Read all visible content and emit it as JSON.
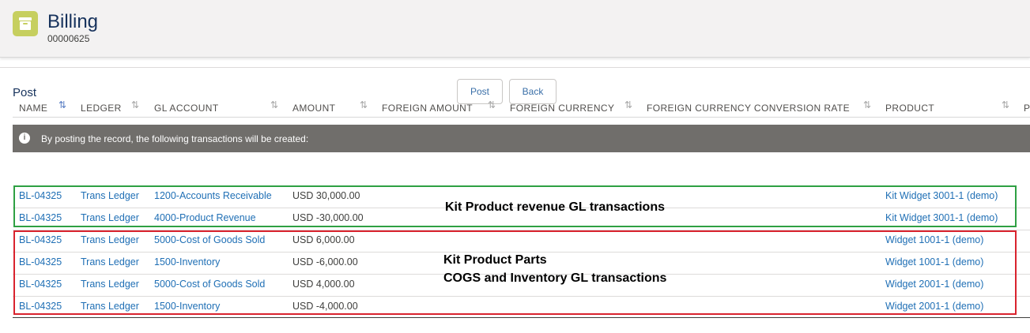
{
  "header": {
    "title": "Billing",
    "record_number": "00000625",
    "icon": "archive-icon"
  },
  "post_section": {
    "label": "Post",
    "post_button": "Post",
    "back_button": "Back"
  },
  "info": {
    "text": "By posting the record, the following transactions will be created:",
    "icon": "info-icon"
  },
  "table": {
    "columns": [
      "NAME",
      "LEDGER",
      "GL ACCOUNT",
      "AMOUNT",
      "FOREIGN AMOUNT",
      "FOREIGN CURRENCY",
      "FOREIGN CURRENCY CONVERSION RATE",
      "PRODUCT",
      "P"
    ],
    "rows": [
      {
        "name": "BL-04325",
        "ledger": "Trans Ledger",
        "gl_account": "1200-Accounts Receivable",
        "amount": "USD 30,000.00",
        "product": "Kit Widget 3001-1 (demo)"
      },
      {
        "name": "BL-04325",
        "ledger": "Trans Ledger",
        "gl_account": "4000-Product Revenue",
        "amount": "USD -30,000.00",
        "product": "Kit Widget 3001-1 (demo)"
      },
      {
        "name": "BL-04325",
        "ledger": "Trans Ledger",
        "gl_account": "5000-Cost of Goods Sold",
        "amount": "USD 6,000.00",
        "product": "Widget 1001-1 (demo)"
      },
      {
        "name": "BL-04325",
        "ledger": "Trans Ledger",
        "gl_account": "1500-Inventory",
        "amount": "USD -6,000.00",
        "product": "Widget 1001-1 (demo)"
      },
      {
        "name": "BL-04325",
        "ledger": "Trans Ledger",
        "gl_account": "5000-Cost of Goods Sold",
        "amount": "USD 4,000.00",
        "product": "Widget 2001-1 (demo)"
      },
      {
        "name": "BL-04325",
        "ledger": "Trans Ledger",
        "gl_account": "1500-Inventory",
        "amount": "USD -4,000.00",
        "product": "Widget 2001-1 (demo)"
      }
    ]
  },
  "annotations": {
    "revenue": "Kit Product revenue GL transactions",
    "parts_line1": "Kit Product Parts",
    "parts_line2": "COGS and Inventory GL transactions",
    "revenue_box_color": "#2ea043",
    "parts_box_color": "#d9232e"
  },
  "colors": {
    "link": "#1f6fb5",
    "icon_bg": "#c6cf5f",
    "info_bar": "#706e6b"
  }
}
